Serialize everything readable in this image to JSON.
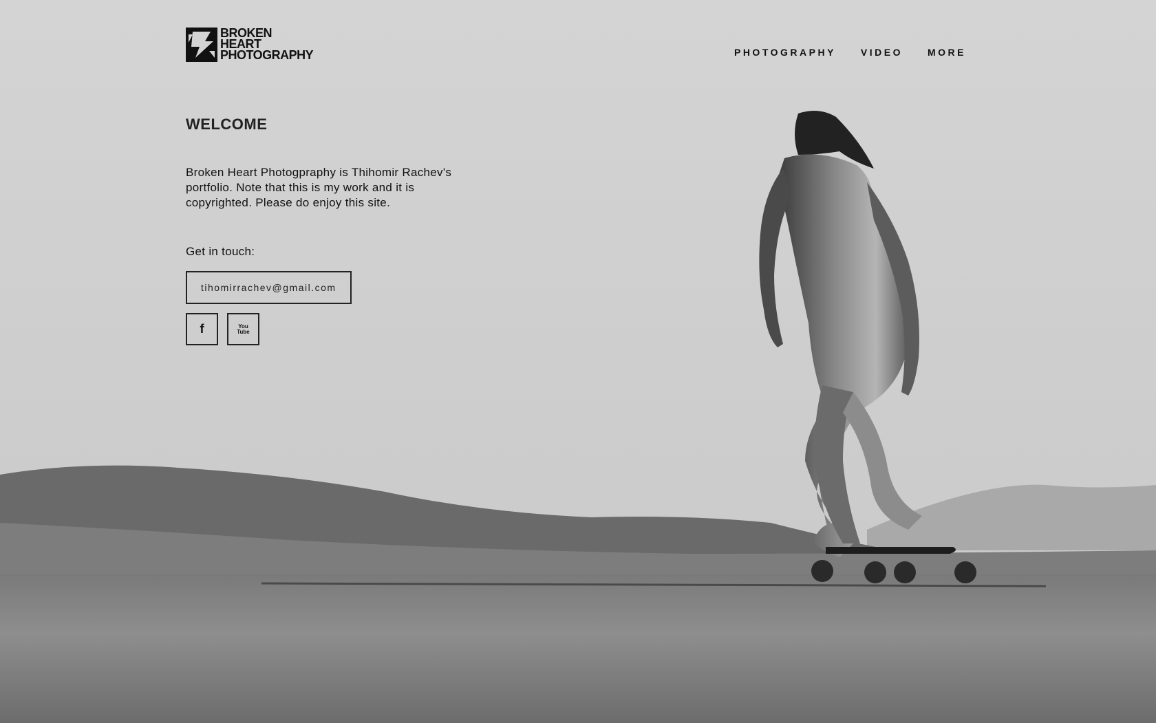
{
  "brand": {
    "logo_lines": [
      "BROKEN",
      "HEART",
      "PHOTOGRAPHY"
    ],
    "logo_icon": "broken-heart-logo-icon"
  },
  "nav": {
    "items": [
      {
        "label": "PHOTOGRAPHY"
      },
      {
        "label": "VIDEO"
      },
      {
        "label": "MORE"
      }
    ]
  },
  "welcome": {
    "title": "WELCOME",
    "intro": "Broken Heart Photogpraphy is Thihomir Rachev's portfolio. Note that this is my work and it is copyrighted. Please do enjoy this site.",
    "contact_label": "Get in touch:",
    "email": "tihomirrachev@gmail.com"
  },
  "social": {
    "facebook_icon": "facebook-icon",
    "facebook_glyph": "f",
    "youtube_icon": "youtube-icon",
    "youtube_glyph_top": "You",
    "youtube_glyph_bottom": "Tube"
  },
  "background": {
    "description_icon": "hero-background-photo"
  },
  "colors": {
    "text": "#111111",
    "border": "#222222"
  }
}
